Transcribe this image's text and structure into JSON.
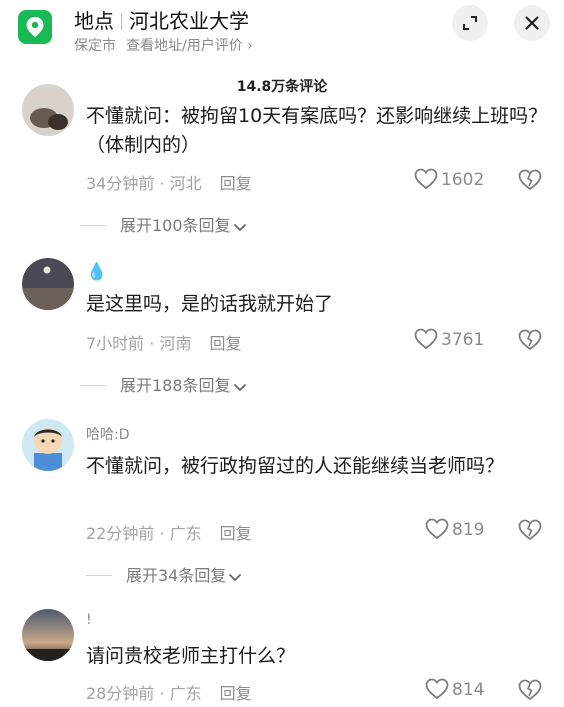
{
  "header": {
    "title_prefix": "地点",
    "title": "河北农业大学",
    "city": "保定市",
    "view_link": "查看地址/用户评价 ›",
    "pin_color": "#19b955",
    "minimize_icon": "minimize-icon",
    "close_icon": "close-icon"
  },
  "comment_count": "14.8万条评论",
  "comments": [
    {
      "username": "",
      "text": "不懂就问：被拘留10天有案底吗？还影响继续上班吗？（体制内的）",
      "time_loc": "34分钟前 · 河北",
      "reply": "回复",
      "likes": "1602",
      "expand": "展开100条回复"
    },
    {
      "username": "💧",
      "text": "是这里吗，是的话我就开始了",
      "time_loc": "7小时前 · 河南",
      "reply": "回复",
      "likes": "3761",
      "expand": "展开188条回复"
    },
    {
      "username": "哈哈:D",
      "text": "不懂就问，被行政拘留过的人还能继续当老师吗？",
      "time_loc": "22分钟前 · 广东",
      "reply": "回复",
      "likes": "819",
      "expand": "展开34条回复"
    },
    {
      "username": "!",
      "text": "请问贵校老师主打什么？",
      "time_loc": "28分钟前 · 广东",
      "reply": "回复",
      "likes": "814",
      "expand": ""
    }
  ]
}
